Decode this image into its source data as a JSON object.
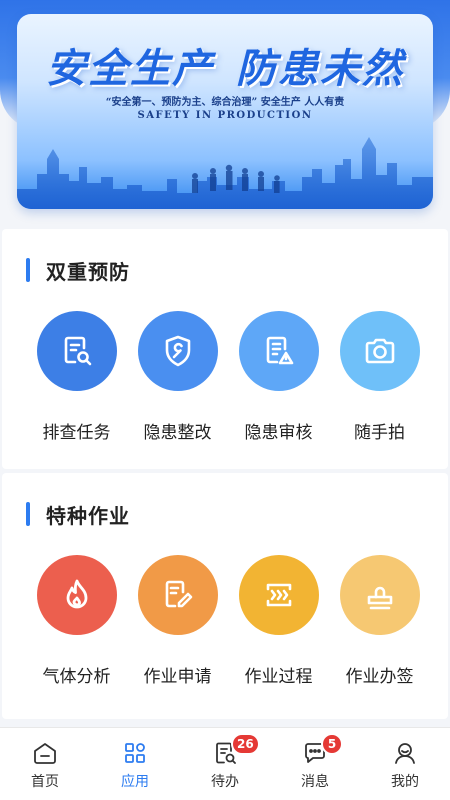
{
  "banner": {
    "title_left": "安全生产",
    "title_right": "防患未然",
    "slogan": "“安全第一、预防为主、综合治理” 安全生产 人人有责",
    "subtitle": "SAFETY IN PRODUCTION"
  },
  "sections": [
    {
      "title": "双重预防",
      "items": [
        {
          "label": "排查任务",
          "icon": "document-search-icon",
          "color": "#3d7fe6"
        },
        {
          "label": "隐患整改",
          "icon": "shield-wrench-icon",
          "color": "#4a8ff0"
        },
        {
          "label": "隐患审核",
          "icon": "document-warning-icon",
          "color": "#5ea7f7"
        },
        {
          "label": "随手拍",
          "icon": "camera-icon",
          "color": "#6fc0f9"
        }
      ]
    },
    {
      "title": "特种作业",
      "items": [
        {
          "label": "气体分析",
          "icon": "flame-icon",
          "color": "#ec5f4e"
        },
        {
          "label": "作业申请",
          "icon": "document-edit-icon",
          "color": "#f19a47"
        },
        {
          "label": "作业过程",
          "icon": "process-arrows-icon",
          "color": "#f2b433"
        },
        {
          "label": "作业办签",
          "icon": "stamp-icon",
          "color": "#f6c872"
        }
      ]
    }
  ],
  "tabbar": {
    "tabs": [
      {
        "label": "首页",
        "icon": "home-icon",
        "active": false
      },
      {
        "label": "应用",
        "icon": "apps-grid-icon",
        "active": true
      },
      {
        "label": "待办",
        "icon": "todo-icon",
        "active": false,
        "badge": "26"
      },
      {
        "label": "消息",
        "icon": "message-icon",
        "active": false,
        "badge": "5"
      },
      {
        "label": "我的",
        "icon": "user-icon",
        "active": false
      }
    ],
    "active_color": "#2d7cf0"
  }
}
